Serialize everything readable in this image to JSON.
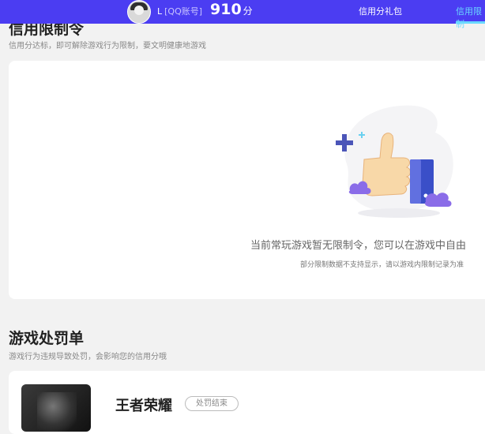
{
  "header": {
    "user_name": "L",
    "account_type": "[QQ账号]",
    "score": "910",
    "score_unit": "分",
    "nav": [
      {
        "label": "信用分礼包"
      },
      {
        "label": "信用限制"
      }
    ]
  },
  "limit_section": {
    "title": "信用限制令",
    "subtitle": "信用分达标，即可解除游戏行为限制，要文明健康地游戏",
    "empty_message": "当前常玩游戏暂无限制令，您可以在游戏中自由",
    "empty_note": "部分限制数据不支持显示，请以游戏内限制记录为准"
  },
  "penalty_section": {
    "title": "游戏处罚单",
    "subtitle": "游戏行为违规导致处罚，会影响您的信用分哦",
    "items": [
      {
        "game_name": "王者荣耀",
        "status": "处罚结束"
      }
    ]
  },
  "colors": {
    "header_bg": "#4b3df2",
    "active_tab": "#6ad8ff"
  }
}
